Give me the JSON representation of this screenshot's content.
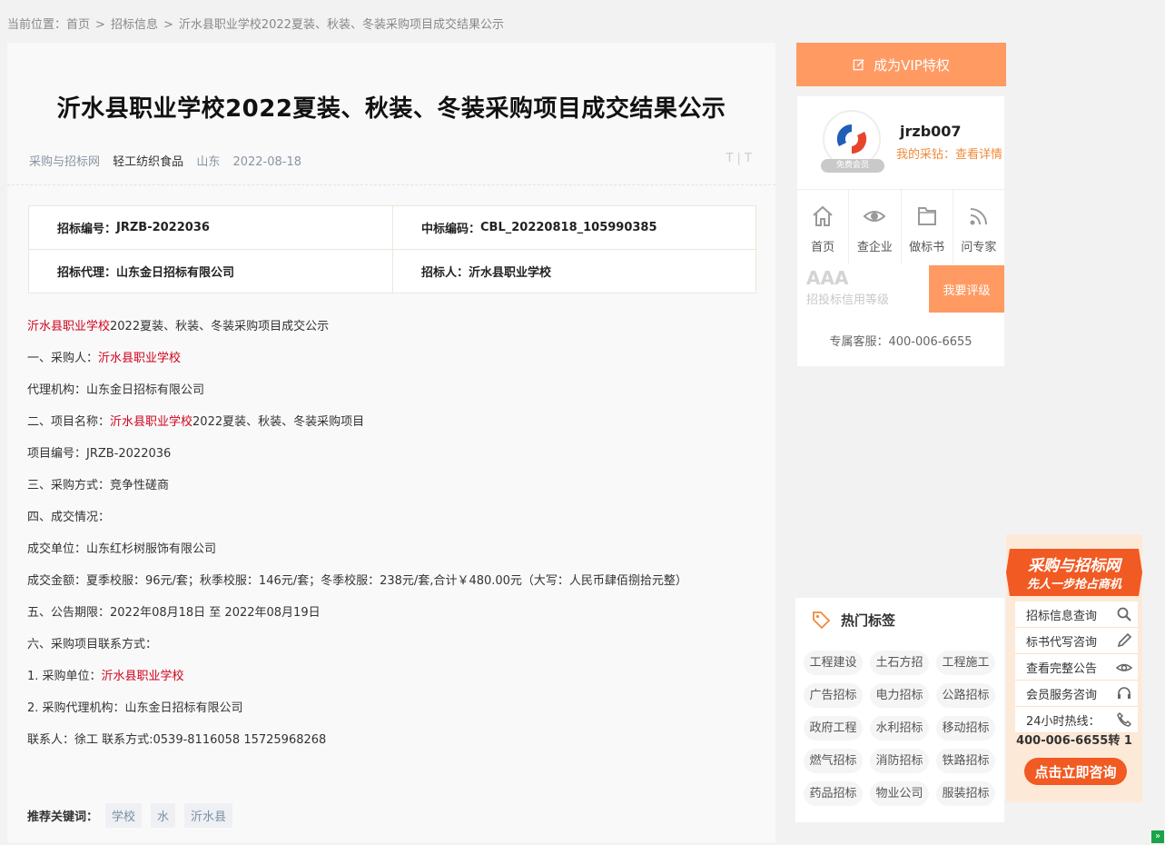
{
  "breadcrumb": {
    "prefix": "当前位置：",
    "home": "首页",
    "sep": ">",
    "category": "招标信息",
    "current": "沂水县职业学校2022夏装、秋装、冬装采购项目成交结果公示"
  },
  "article": {
    "title": "沂水县职业学校2022夏装、秋装、冬装采购项目成交结果公示",
    "meta": {
      "site": "采购与招标网",
      "category": "轻工纺织食品",
      "region": "山东",
      "date": "2022-08-18",
      "font_size": "T | T"
    },
    "info": {
      "bid_no_label": "招标编号：",
      "bid_no": "JRZB-2022036",
      "win_code_label": "中标编码：",
      "win_code": "CBL_20220818_105990385",
      "agent_label": "招标代理：",
      "agent": "山东金日招标有限公司",
      "tenderer_label": "招标人：",
      "tenderer": "沂水县职业学校"
    },
    "body": {
      "l1_link": "沂水县职业学校",
      "l1_text": "2022夏装、秋装、冬装采购项目成交公示",
      "l2_text": "一、采购人：",
      "l2_link": "沂水县职业学校",
      "l3": "代理机构：山东金日招标有限公司",
      "l4_text": "二、项目名称：",
      "l4_link": "沂水县职业学校",
      "l4_tail": "2022夏装、秋装、冬装采购项目",
      "l5": "项目编号：JRZB-2022036",
      "l6": "三、采购方式：竞争性磋商",
      "l7": "四、成交情况：",
      "l8": "成交单位：山东红杉树服饰有限公司",
      "l9": "成交金额：夏季校服：96元/套；秋季校服：146元/套；冬季校服：238元/套,合计￥480.00元（大写：人民币肆佰捌拾元整）",
      "l10": "五、公告期限：2022年08月18日 至 2022年08月19日",
      "l11": "六、采购项目联系方式：",
      "l12_text": "1. 采购单位：",
      "l12_link": "沂水县职业学校",
      "l13": "2. 采购代理机构：山东金日招标有限公司",
      "l14": "联系人：徐工 联系方式:0539-8116058 15725968268"
    },
    "keywords_label": "推荐关键词：",
    "keywords": [
      "学校",
      "水",
      "沂水县"
    ]
  },
  "sidebar": {
    "vip_label": "成为VIP特权",
    "avatar_badge": "免费会员",
    "username": "jrzb007",
    "points_prefix": "我的采钻：",
    "points_link": "查看详情",
    "shortcuts": [
      {
        "label": "首页",
        "icon": "home-icon"
      },
      {
        "label": "查企业",
        "icon": "eye-icon"
      },
      {
        "label": "做标书",
        "icon": "folder-icon"
      },
      {
        "label": "问专家",
        "icon": "rss-icon"
      }
    ],
    "rating_level": "AAA",
    "rating_desc": "招投标信用等级",
    "rating_button": "我要评级",
    "service": "专属客服：400-006-6655"
  },
  "hot_tags": {
    "title": "热门标签",
    "tags": [
      "工程建设",
      "土石方招",
      "工程施工",
      "广告招标",
      "电力招标",
      "公路招标",
      "政府工程",
      "水利招标",
      "移动招标",
      "燃气招标",
      "消防招标",
      "铁路招标",
      "药品招标",
      "物业公司",
      "服装招标"
    ]
  },
  "promo": {
    "brand": "采购与招标网",
    "slogan": "先人一步抢占商机",
    "items": [
      {
        "label": "招标信息查询",
        "icon": "search-icon"
      },
      {
        "label": "标书代写咨询",
        "icon": "pencil-icon"
      },
      {
        "label": "查看完整公告",
        "icon": "eye-icon"
      },
      {
        "label": "会员服务咨询",
        "icon": "headset-icon"
      },
      {
        "label": "24小时热线：",
        "icon": "phone-icon"
      }
    ],
    "hotline": "400-006-6655转 1",
    "button": "点击立即咨询"
  },
  "colors": {
    "accent": "#ff9a63",
    "link_red": "#d0021b",
    "promo_red": "#f15a22"
  }
}
